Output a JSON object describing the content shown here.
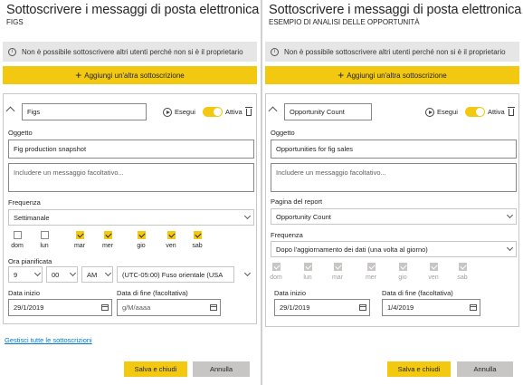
{
  "left": {
    "title": "Sottoscrivere i messaggi di posta elettronica",
    "subtitle": "FIGS",
    "info_text": "Non è possibile sottoscrivere altri utenti perché non si è il proprietario",
    "add_label": "Aggiungi un'altra sottoscrizione",
    "subscription_name": "Figs",
    "run_label": "Esegui",
    "active_label": "Attiva",
    "subject_label": "Oggetto",
    "subject_value": "Fig production snapshot",
    "message_placeholder": "Includere un messaggio facoltativo...",
    "frequency_label": "Frequenza",
    "frequency_value": "Settimanale",
    "days": [
      {
        "label": "dom",
        "checked": false
      },
      {
        "label": "lun",
        "checked": false
      },
      {
        "label": "mar",
        "checked": true
      },
      {
        "label": "mer",
        "checked": true
      },
      {
        "label": "gio",
        "checked": true
      },
      {
        "label": "ven",
        "checked": true
      },
      {
        "label": "sab",
        "checked": true
      }
    ],
    "scheduled_time_label": "Ora pianificata",
    "hour": "9",
    "minute": "00",
    "ampm": "AM",
    "timezone": "(UTC-05:00) Fuso orientale (USA",
    "start_date_label": "Data inizio",
    "start_date": "29/1/2019",
    "end_date_label": "Data di fine (facoltativa)",
    "end_date_placeholder": "g/M/aaaa",
    "manage_link": "Gestisci tutte le sottoscrizioni",
    "save_label": "Salva e chiudi",
    "cancel_label": "Annulla"
  },
  "right": {
    "title": "Sottoscrivere i messaggi di posta elettronica",
    "subtitle": "ESEMPIO DI ANALISI DELLE OPPORTUNITÀ",
    "info_text": "Non è possibile sottoscrivere altri utenti perché non si è il proprietario",
    "add_label": "Aggiungi un'altra sottoscrizione",
    "subscription_name": "Opportunity Count",
    "run_label": "Esegui",
    "active_label": "Attiva",
    "subject_label": "Oggetto",
    "subject_value": "Opportunities for fig sales",
    "message_placeholder": "Includere un messaggio facoltativo...",
    "report_page_label": "Pagina del report",
    "report_page_value": "Opportunity Count",
    "frequency_label": "Frequenza",
    "frequency_value": "Dopo l'aggiornamento dei dati (una volta al giorno)",
    "days": [
      {
        "label": "dom"
      },
      {
        "label": "lun"
      },
      {
        "label": "mar"
      },
      {
        "label": "mer"
      },
      {
        "label": "gio"
      },
      {
        "label": "ven"
      },
      {
        "label": "sab"
      }
    ],
    "start_date_label": "Data inizio",
    "start_date": "29/1/2019",
    "end_date_label": "Data di fine (facoltativa)",
    "end_date": "1/4/2019",
    "save_label": "Salva e chiudi",
    "cancel_label": "Annulla"
  },
  "colors": {
    "accent": "#f2c811",
    "link": "#0078d4",
    "banner": "#e6e6e6"
  },
  "icons": [
    "info-icon",
    "plus-icon",
    "chevron-up-icon",
    "play-icon",
    "toggle-switch",
    "trash-icon",
    "chevron-down-icon",
    "calendar-icon"
  ]
}
